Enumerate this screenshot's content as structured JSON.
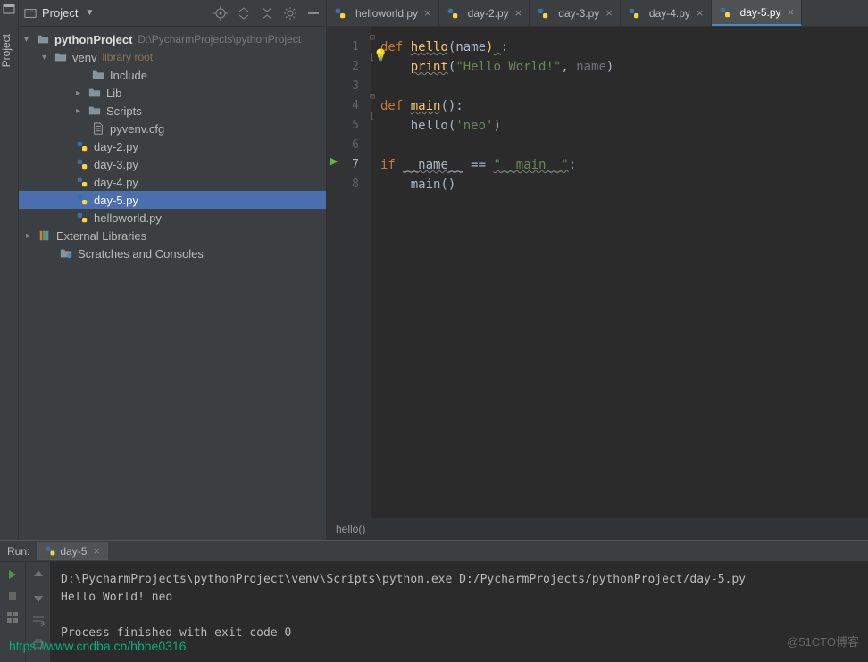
{
  "sidebar": {
    "label": "Project"
  },
  "project_header": {
    "title": "Project"
  },
  "tree": {
    "root": {
      "name": "pythonProject",
      "path": "D:\\PycharmProjects\\pythonProject"
    },
    "venv": {
      "name": "venv",
      "tag": "library root"
    },
    "venv_children": [
      {
        "name": "Include"
      },
      {
        "name": "Lib"
      },
      {
        "name": "Scripts"
      },
      {
        "name": "pyvenv.cfg",
        "file": true
      }
    ],
    "py_files": [
      "day-2.py",
      "day-3.py",
      "day-4.py",
      "day-5.py",
      "helloworld.py"
    ],
    "ext_lib": "External Libraries",
    "scratches": "Scratches and Consoles"
  },
  "tabs": [
    "helloworld.py",
    "day-2.py",
    "day-3.py",
    "day-4.py",
    "day-5.py"
  ],
  "active_tab": "day-5.py",
  "code": {
    "lines": [
      "1",
      "2",
      "3",
      "4",
      "5",
      "6",
      "7",
      "8"
    ],
    "l1": {
      "def": "def ",
      "fn": "hello",
      "open": "(",
      "prm": "name",
      "close": ")",
      "colon": ":"
    },
    "l2": {
      "fn": "print",
      "open": "(",
      "str": "\"Hello World!\"",
      "comma": ", ",
      "prm": "name",
      "close": ")"
    },
    "l4": {
      "def": "def ",
      "fn": "main",
      "rest": "():"
    },
    "l5": {
      "call": "hello(",
      "str": "'neo'",
      "close": ")"
    },
    "l7": {
      "kw": "if ",
      "name": "__name__",
      "eq": " == ",
      "str": "\"__main__\"",
      "colon": ":"
    },
    "l8": {
      "call": "main()"
    }
  },
  "breadcrumb": "hello()",
  "run": {
    "label": "Run:",
    "tab": "day-5",
    "lines": [
      "D:\\PycharmProjects\\pythonProject\\venv\\Scripts\\python.exe D:/PycharmProjects/pythonProject/day-5.py",
      "Hello World! neo",
      "",
      "Process finished with exit code 0"
    ]
  },
  "watermark": {
    "url": "https://www.cndba.cn/hbhe0316",
    "blog": "@51CTO博客"
  }
}
